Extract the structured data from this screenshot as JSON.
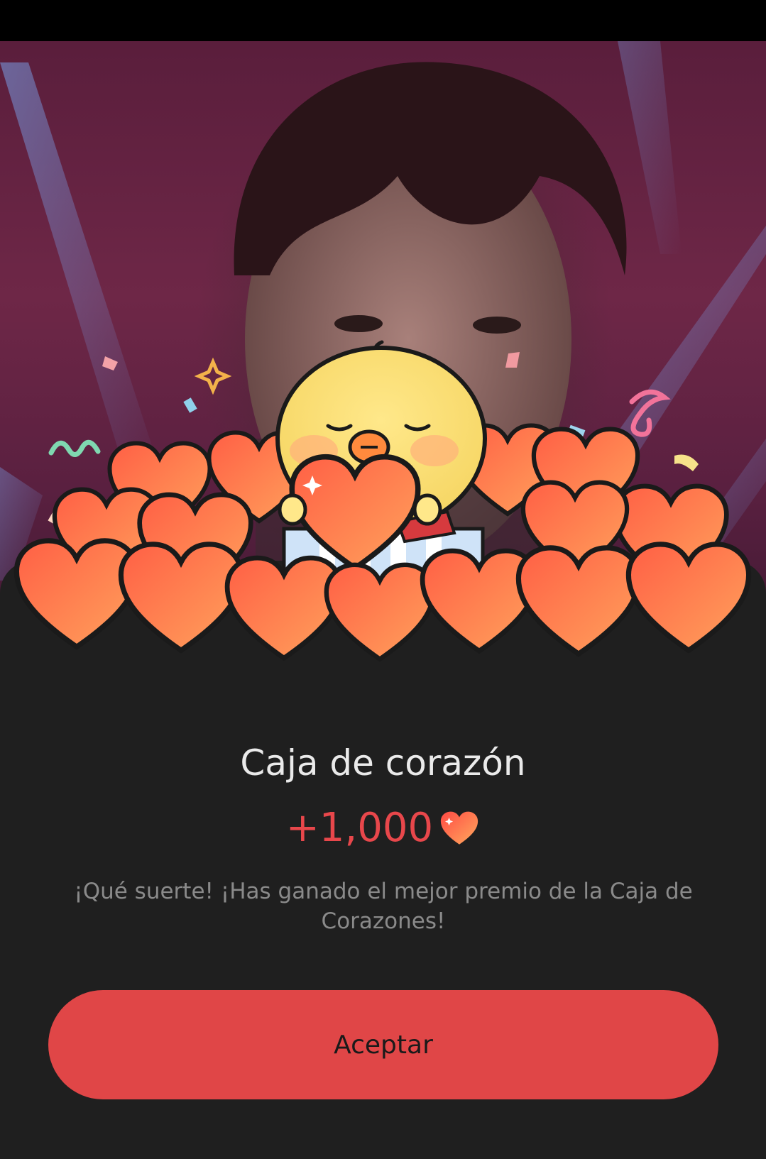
{
  "dialog": {
    "title": "Caja de corazón",
    "reward_amount": "+1,000",
    "reward_icon": "heart-icon",
    "message": "¡Qué suerte! ¡Has ganado el mejor premio de la Caja de Corazones!",
    "accept_label": "Aceptar"
  },
  "illustration": {
    "subject": "chick-character",
    "decor": "hearts-pile"
  },
  "colors": {
    "accent": "#e04647",
    "reward_text": "#e8474b",
    "sheet_bg": "#1f1f1f",
    "title_text": "#eaeaea",
    "message_text": "#8a8a8a"
  }
}
